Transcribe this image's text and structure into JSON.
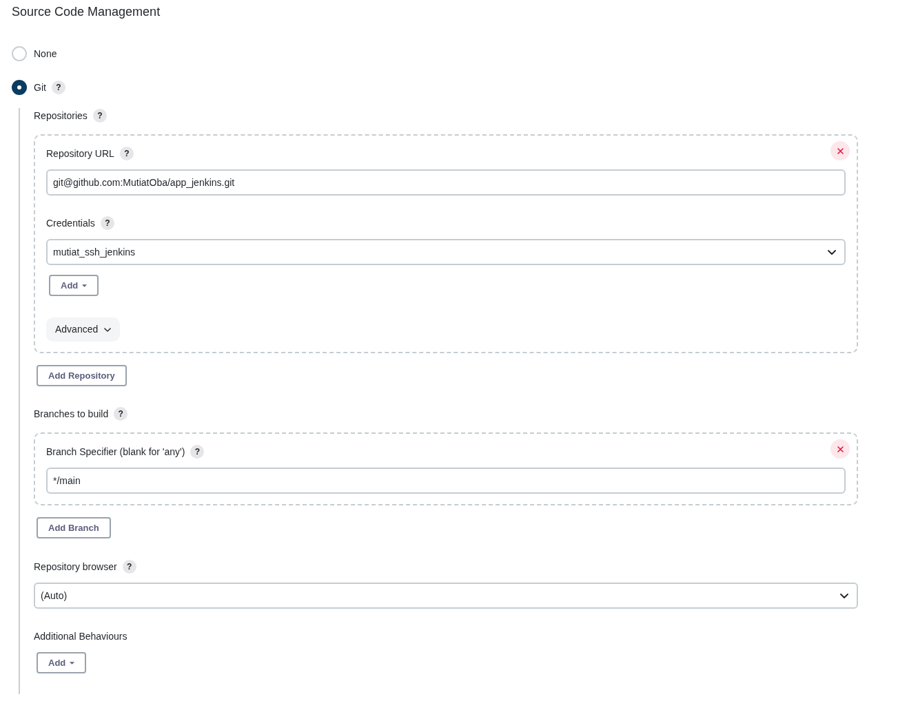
{
  "section": {
    "title": "Source Code Management"
  },
  "scm_options": [
    {
      "label": "None",
      "selected": false
    },
    {
      "label": "Git",
      "selected": true,
      "help": "?"
    }
  ],
  "git": {
    "repositories": {
      "label": "Repositories",
      "help": "?",
      "entries": [
        {
          "fields": [
            {
              "kind": "text",
              "label": "Repository URL",
              "help": "?",
              "value": "git@github.com:MutiatOba/app_jenkins.git"
            },
            {
              "kind": "select",
              "label": "Credentials",
              "help": "?",
              "value": "mutiat_ssh_jenkins",
              "add_button": {
                "label": "Add",
                "dropdown": true
              }
            }
          ],
          "advanced_button": "Advanced"
        }
      ],
      "add_button": {
        "label": "Add Repository"
      }
    },
    "branches": {
      "label": "Branches to build",
      "help": "?",
      "entries": [
        {
          "fields": [
            {
              "kind": "text",
              "label": "Branch Specifier (blank for 'any')",
              "help": "?",
              "value": "*/main"
            }
          ]
        }
      ],
      "add_button": {
        "label": "Add Branch"
      }
    },
    "repository_browser": {
      "kind": "select",
      "label": "Repository browser",
      "help": "?",
      "value": "(Auto)"
    },
    "additional_behaviours": {
      "label": "Additional Behaviours",
      "add_button": {
        "label": "Add",
        "dropdown": true
      }
    }
  }
}
